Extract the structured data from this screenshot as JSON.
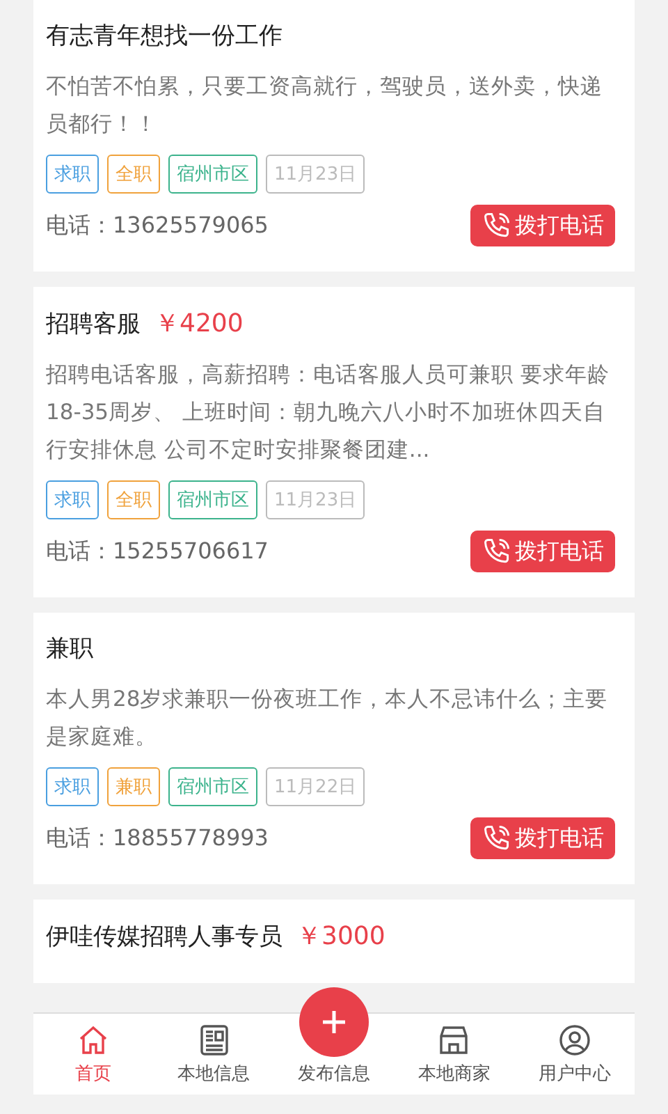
{
  "listings": [
    {
      "title": "有志青年想找一份工作",
      "description": "不怕苦不怕累，只要工资高就行，驾驶员，送外卖，快递员都行！！",
      "tags": [
        {
          "text": "求职",
          "color": "#4a9fe0"
        },
        {
          "text": "全职",
          "color": "#f0a23c"
        },
        {
          "text": "宿州市区",
          "color": "#3cb38c"
        },
        {
          "text": "11月23日",
          "color": "#bbbbbb"
        }
      ],
      "phone": "电话：13625579065",
      "call_button": "拨打电话"
    },
    {
      "title": "招聘客服",
      "salary": "￥4200",
      "description": "招聘电话客服，高薪招聘：电话客服人员可兼职 要求年龄18-35周岁、 上班时间：朝九晚六八小时不加班休四天自行安排休息 公司不定时安排聚餐团建...",
      "tags": [
        {
          "text": "求职",
          "color": "#4a9fe0"
        },
        {
          "text": "全职",
          "color": "#f0a23c"
        },
        {
          "text": "宿州市区",
          "color": "#3cb38c"
        },
        {
          "text": "11月23日",
          "color": "#bbbbbb"
        }
      ],
      "phone": "电话：15255706617",
      "call_button": "拨打电话"
    },
    {
      "title": "兼职",
      "description": "本人男28岁求兼职一份夜班工作，本人不忌讳什么；主要是家庭难。",
      "tags": [
        {
          "text": "求职",
          "color": "#4a9fe0"
        },
        {
          "text": "兼职",
          "color": "#f0a23c"
        },
        {
          "text": "宿州市区",
          "color": "#3cb38c"
        },
        {
          "text": "11月22日",
          "color": "#bbbbbb"
        }
      ],
      "phone": "电话：18855778993",
      "call_button": "拨打电话"
    },
    {
      "title": "伊哇传媒招聘人事专员",
      "salary": "￥3000"
    }
  ],
  "tab_bar": [
    {
      "label": "首页",
      "kind": "home",
      "selected": true
    },
    {
      "label": "本地信息",
      "kind": "news",
      "selected": false
    },
    {
      "label": "发布信息",
      "kind": "publish",
      "selected": false
    },
    {
      "label": "本地商家",
      "kind": "shop",
      "selected": false
    },
    {
      "label": "用户中心",
      "kind": "user",
      "selected": false
    }
  ]
}
